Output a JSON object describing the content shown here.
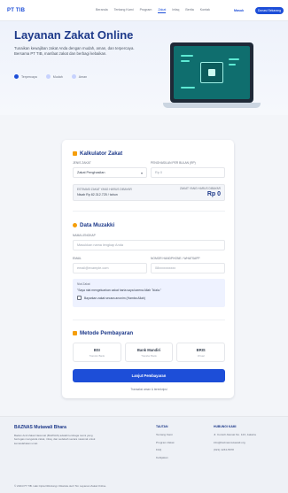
{
  "header": {
    "logo": "PT TIB",
    "nav": [
      "Beranda",
      "Tentang Kami",
      "Program",
      "Zakat",
      "Infaq",
      "Berita",
      "Kontak"
    ],
    "active_nav": "Zakat",
    "login": "Masuk",
    "cta": "Donasi Sekarang"
  },
  "hero": {
    "title": "Layanan Zakat Online",
    "description": "Tunaikan kewajiban zakat Anda dengan mudah, aman, dan terpercaya. Bersama PT TIB, manfaat zakat dan berbagi kebaikan.",
    "stats": [
      "Terpercaya",
      "Mudah",
      "Aman"
    ]
  },
  "calculator": {
    "title": "Kalkulator Zakat",
    "type_label": "JENIS ZAKAT",
    "type_value": "Zakat Penghasilan",
    "income_label": "PENGHASILAN PER BULAN (RP)",
    "income_placeholder": "Rp 0",
    "result_label": "ESTIMASI ZAKAT YANG HARUS DIBAYAR",
    "result_nisab": "Nisab Rp 82.312.725 / tahun",
    "result_right_label": "ZAKAT YANG HARUS DIBAYAR",
    "result_value": "Rp 0"
  },
  "donor": {
    "title": "Data Muzakki",
    "name_label": "NAMA LENGKAP",
    "name_placeholder": "Masukkan nama lengkap Anda",
    "email_label": "EMAIL",
    "email_placeholder": "email@example.com",
    "phone_label": "NOMOR HANDPHONE / WHATSAPP",
    "phone_placeholder": "08xxxxxxxxxx",
    "niat_label": "Niat Zakat",
    "niat_text": "\"Saya niat mengeluarkan zakat harta saya karena Allah Ta'ala.\"",
    "anon_label": "Bayarkan zakat secara anonim (Hamba Allah)"
  },
  "payment": {
    "title": "Metode Pembayaran",
    "methods": [
      {
        "name": "BSI",
        "sub": "Transfer Bank"
      },
      {
        "name": "Bank Mandiri",
        "sub": "Transfer Bank"
      },
      {
        "name": "BRIS",
        "sub": "Virtual"
      }
    ],
    "button": "Lanjut Pembayaran",
    "secure": "Transaksi aman & terenkripsi"
  },
  "footer": {
    "brand": "BAZNAS Mutawali Bhara",
    "description": "Badan Amil Zakat Nasional (BAZNAS) adalah lembaga resmi yang bertugas mengelola zakat, infaq, dan sedekah secara nasional untuk kemaslahatan umat.",
    "col1_title": "TAUTAN",
    "col1_items": [
      "Tentang Kami",
      "Program Zakat",
      "FAQ",
      "Kebijakan"
    ],
    "col2_title": "HUBUNGI KAMI",
    "col2_items": [
      "Jl. Contoh Alamat No. 123, Jakarta",
      "info@baznasmutawali.org",
      "(021) 1234-5678"
    ],
    "copyright": "© 2024 PT TIB. Hak Cipta Dilindungi. Dikelola oleh Tim Layanan Zakat Online."
  }
}
